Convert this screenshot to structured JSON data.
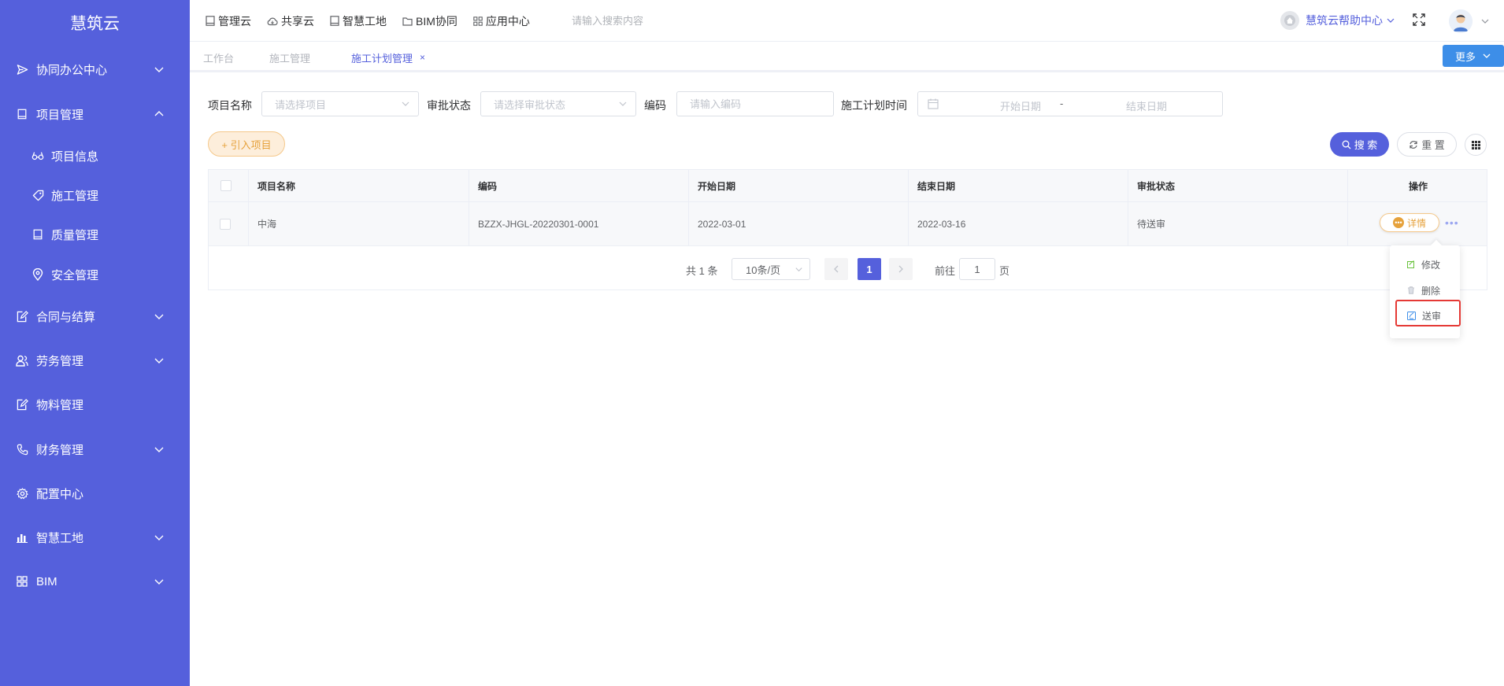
{
  "app": {
    "brand": "慧筑云"
  },
  "sidebar": {
    "items": [
      {
        "label": "协同办公中心",
        "icon": "send-icon",
        "expanded": false
      },
      {
        "label": "项目管理",
        "icon": "book-icon",
        "expanded": true,
        "children": [
          {
            "label": "项目信息",
            "icon": "glasses-icon"
          },
          {
            "label": "施工管理",
            "icon": "tag-icon"
          },
          {
            "label": "质量管理",
            "icon": "book-icon"
          },
          {
            "label": "安全管理",
            "icon": "location-icon"
          }
        ]
      },
      {
        "label": "合同与结算",
        "icon": "edit-document-icon",
        "expanded": false
      },
      {
        "label": "劳务管理",
        "icon": "user-group-icon",
        "expanded": false
      },
      {
        "label": "物料管理",
        "icon": "edit-document-icon"
      },
      {
        "label": "财务管理",
        "icon": "phone-icon",
        "expanded": false
      },
      {
        "label": "配置中心",
        "icon": "gear-icon"
      },
      {
        "label": "智慧工地",
        "icon": "bar-chart-icon",
        "expanded": false
      },
      {
        "label": "BIM",
        "icon": "grid-icon",
        "expanded": false
      }
    ]
  },
  "topbar": {
    "nav": [
      {
        "label": "管理云",
        "icon": "book-icon"
      },
      {
        "label": "共享云",
        "icon": "cloud-icon"
      },
      {
        "label": "智慧工地",
        "icon": "book-icon"
      },
      {
        "label": "BIM协同",
        "icon": "folder-icon"
      },
      {
        "label": "应用中心",
        "icon": "grid-icon"
      }
    ],
    "search_placeholder": "请输入搜索内容",
    "help_label": "慧筑云帮助中心"
  },
  "tabs": {
    "items": [
      {
        "label": "工作台",
        "active": false
      },
      {
        "label": "施工管理",
        "active": false
      },
      {
        "label": "施工计划管理",
        "active": true
      }
    ],
    "close_glyph": "×",
    "more_label": "更多"
  },
  "filters": {
    "project_label": "项目名称",
    "project_placeholder": "请选择项目",
    "status_label": "审批状态",
    "status_placeholder": "请选择审批状态",
    "code_label": "编码",
    "code_placeholder": "请输入编码",
    "date_label": "施工计划时间",
    "start_placeholder": "开始日期",
    "range_separator": "-",
    "end_placeholder": "结束日期"
  },
  "actions": {
    "import_label": "+ 引入项目",
    "search_label": "搜 索",
    "reset_label": "重 置"
  },
  "table": {
    "columns": [
      "项目名称",
      "编码",
      "开始日期",
      "结束日期",
      "审批状态",
      "操作"
    ],
    "rows": [
      {
        "name": "中海",
        "code": "BZZX-JHGL-20220301-0001",
        "start": "2022-03-01",
        "end": "2022-03-16",
        "status": "待送审",
        "detail_label": "详情"
      }
    ]
  },
  "pagination": {
    "total_label": "共 1 条",
    "page_size": "10条/页",
    "current_page": "1",
    "goto_label": "前往",
    "goto_value": "1",
    "page_suffix": "页"
  },
  "row_menu": {
    "items": [
      {
        "label": "修改",
        "icon": "edit-icon",
        "color": "#67c23a"
      },
      {
        "label": "删除",
        "icon": "trash-icon",
        "color": "#c0c4cc"
      },
      {
        "label": "送审",
        "icon": "submit-icon",
        "color": "#3d8ee8",
        "highlighted": true
      }
    ]
  },
  "colors": {
    "sidebar_bg": "#5560dc",
    "primary": "#5560dc",
    "warning": "#e6a23c",
    "highlight_border": "#e53935"
  }
}
